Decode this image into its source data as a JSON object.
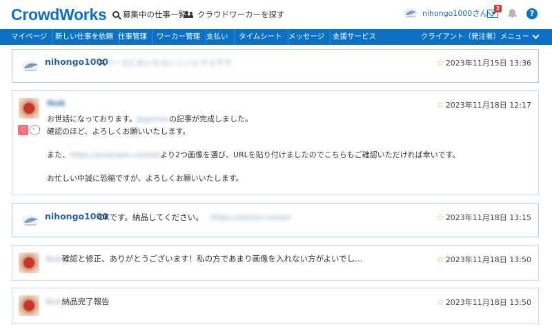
{
  "header": {
    "logo": "CrowdWorks",
    "links": {
      "search": "募集中の仕事一覧",
      "workers": "クラウドワーカーを探す"
    },
    "user": {
      "name": "nihongo1000さん",
      "mail_count": "2",
      "help": "?"
    }
  },
  "nav": {
    "items": [
      "マイページ",
      "新しい仕事を依頼",
      "仕事管理",
      "ワーカー管理",
      "支払い",
      "タイムシート",
      "メッセージ",
      "支援サービス"
    ],
    "menu": "クライアント（発注者）メニュー"
  },
  "messages": [
    {
      "sender": "nihongo1000",
      "text": "ス",
      "blurred_text": "ペースにおいたらいこいにヤエヤヤ",
      "time": "2023年11月15日 13:36"
    },
    {
      "sender": "Ikuk",
      "lines": [
        {
          "pre": "お世話になっております。",
          "blur": "Jagemas",
          "post": "の記事が完成しました。"
        },
        {
          "pre": "確認のほど、よろしくお願いいたします。",
          "blur": "",
          "post": ""
        },
        {
          "pre": "また、",
          "blur": "https://example.com/ad",
          "post": "より2つ画像を選び、URLを貼り付けましたのでこちらもご確認いただければ幸いです。"
        },
        {
          "pre": "お忙しい中誠に恐縮ですが、よろしくお願いいたします。",
          "blur": "",
          "post": ""
        }
      ],
      "time": "2023年11月18日 12:17",
      "reactions": {
        "heart": "♡",
        "face": "・・"
      }
    },
    {
      "sender": "nihongo1000",
      "text": "OKです。納品してください。",
      "blurred_text": "https://senior-roman",
      "time": "2023年11月18日 13:15"
    },
    {
      "sender": "Ikuk",
      "text": "確認と修正、ありがとうございます！私の方であまり画像を入れない方がよいでし…",
      "time": "2023年11月18日 13:50"
    },
    {
      "sender": "Ikuk",
      "text": "納品完了報告",
      "time": "2023年11月18日 13:50"
    }
  ]
}
